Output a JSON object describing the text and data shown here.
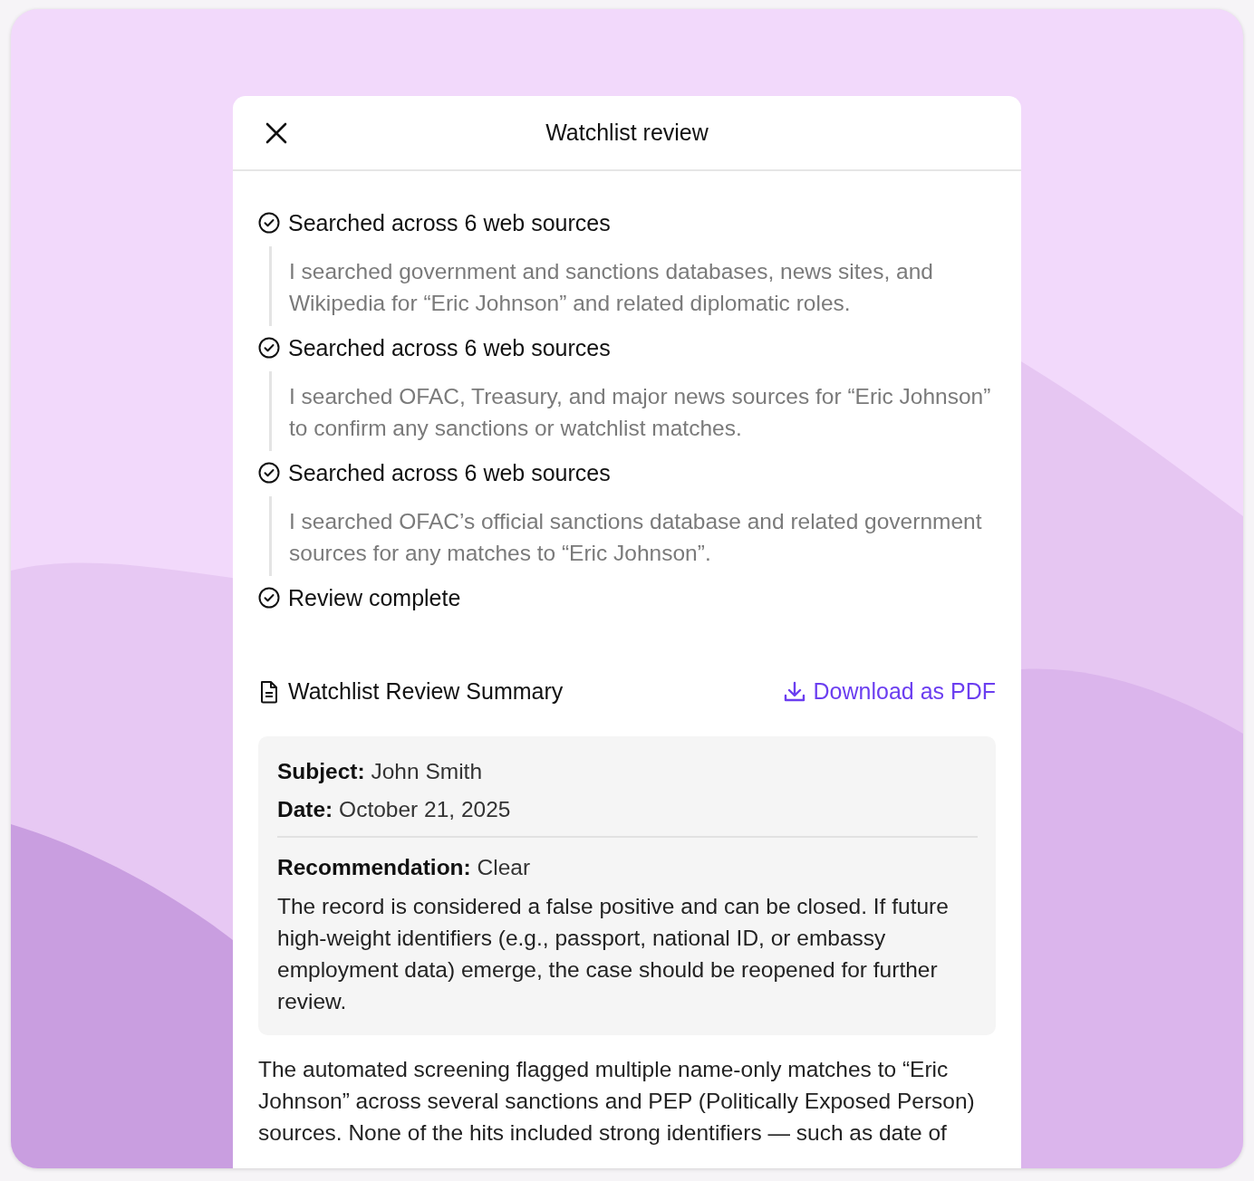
{
  "dialog": {
    "title": "Watchlist review"
  },
  "steps": [
    {
      "title": "Searched across 6 web sources",
      "detail": "I searched government and sanctions databases, news sites, and Wikipedia for “Eric Johnson” and related diplomatic roles."
    },
    {
      "title": "Searched across 6 web sources",
      "detail": "I searched OFAC, Treasury, and major news sources for “Eric Johnson” to confirm any sanctions or watchlist matches."
    },
    {
      "title": "Searched across 6 web sources",
      "detail": "I searched OFAC’s official sanctions database and related government sources for any matches to “Eric Johnson”."
    },
    {
      "title": "Review complete"
    }
  ],
  "summary": {
    "title": "Watchlist Review Summary",
    "download": "Download as PDF",
    "fields": [
      "**Subject:** John Smith",
      "**Date:** October 21, 2025"
    ],
    "recommendation": "**Recommendation:** Clear",
    "note": "The record is considered a false positive and can be closed. If future high-weight identifiers (e.g., passport, national ID, or embassy employment data) emerge, the case should be reopened for further review."
  },
  "body_text": "The automated screening flagged multiple name-only matches to “Eric Johnson” across several sanctions and PEP (Politically Exposed Person) sources. None of the hits included strong identifiers — such as date of"
}
